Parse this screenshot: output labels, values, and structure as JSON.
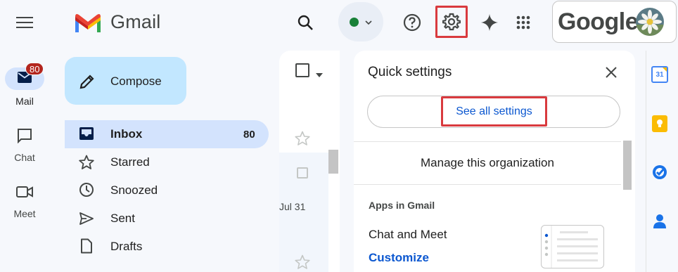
{
  "app": {
    "logo_text": "Gmail",
    "account_brand": "Google"
  },
  "rail": {
    "mail": {
      "label": "Mail",
      "badge": "80"
    },
    "chat": {
      "label": "Chat"
    },
    "meet": {
      "label": "Meet"
    }
  },
  "compose": {
    "label": "Compose"
  },
  "nav": [
    {
      "label": "Inbox",
      "count": "80",
      "icon": "inbox-icon",
      "active": true
    },
    {
      "label": "Starred",
      "icon": "star-icon"
    },
    {
      "label": "Snoozed",
      "icon": "clock-icon"
    },
    {
      "label": "Sent",
      "icon": "send-icon"
    },
    {
      "label": "Drafts",
      "icon": "draft-icon"
    }
  ],
  "list": {
    "date": "Jul 31"
  },
  "quick_settings": {
    "title": "Quick settings",
    "see_all": "See all settings",
    "manage": "Manage this organization",
    "apps_heading": "Apps in Gmail",
    "chat_meet": "Chat and Meet",
    "customize": "Customize"
  },
  "side_apps": {
    "calendar_day": "31"
  },
  "colors": {
    "accent_blue": "#0b57d0",
    "highlight_red": "#d93a3e",
    "compose_bg": "#c2e7ff",
    "active_nav_bg": "#d3e3fd",
    "status_green": "#188038"
  }
}
